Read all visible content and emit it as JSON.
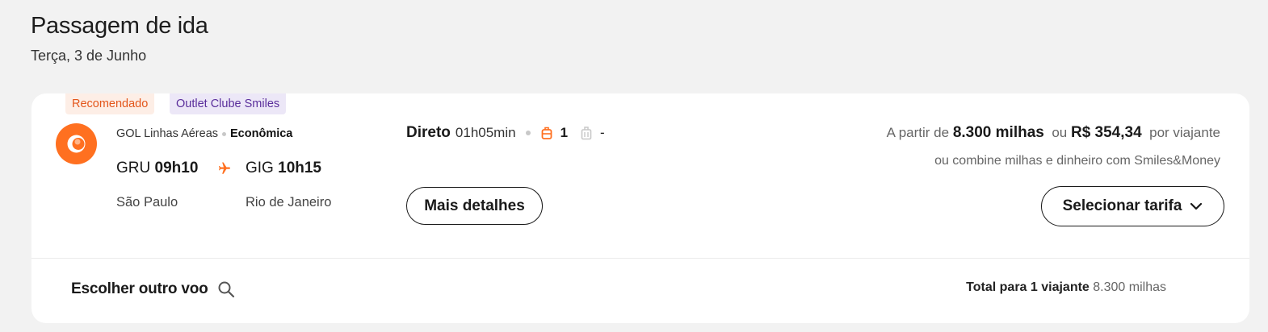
{
  "header": {
    "title": "Passagem de ida",
    "date": "Terça, 3 de Junho"
  },
  "flight": {
    "badges": [
      "Recomendado",
      "Outlet Clube Smiles"
    ],
    "airline": "GOL Linhas Aéreas",
    "cabin": "Econômica",
    "origin": {
      "code": "GRU",
      "time": "09h10",
      "city": "São Paulo"
    },
    "destination": {
      "code": "GIG",
      "time": "10h15",
      "city": "Rio de Janeiro"
    },
    "stops": "Direto",
    "duration": "01h05min",
    "carry_on_count": "1",
    "checked_bag": "-",
    "details_button": "Mais detalhes",
    "price": {
      "prefix": "A partir de",
      "miles": "8.300 milhas",
      "or": "ou",
      "money": "R$ 354,34",
      "suffix": "por viajante",
      "combine_text": "ou combine milhas e dinheiro com Smiles&Money"
    },
    "select_fare_button": "Selecionar tarifa",
    "other_flight_label": "Escolher outro voo",
    "total": {
      "label": "Total para 1 viajante",
      "value": "8.300 milhas"
    }
  },
  "colors": {
    "brand_orange": "#ff7020",
    "recommended_text": "#e3561b",
    "outlet_text": "#5a2e9b"
  },
  "icons": [
    "gol-logo-icon",
    "plane-icon",
    "carry-on-bag-icon",
    "checked-bag-icon",
    "chevron-down-icon",
    "search-icon"
  ]
}
